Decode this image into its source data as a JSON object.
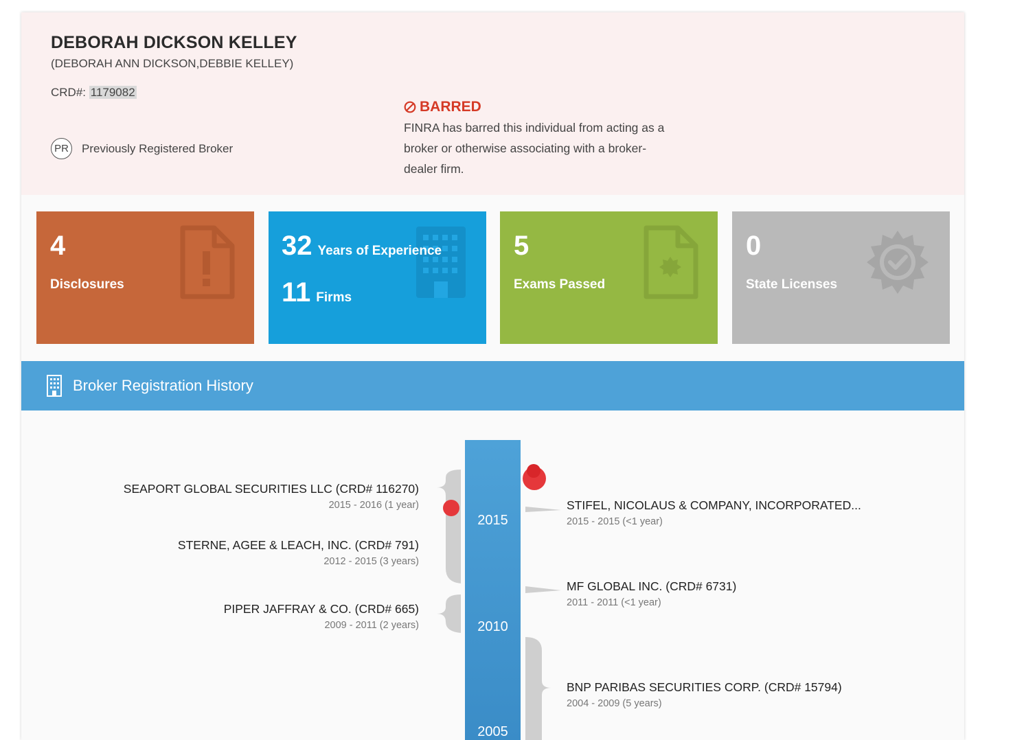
{
  "profile": {
    "name": "DEBORAH DICKSON KELLEY",
    "aliases": "(DEBORAH ANN DICKSON,DEBBIE KELLEY)",
    "crd_label": "CRD#:",
    "crd_number": "1179082",
    "status_badge": "PR",
    "status_label": "Previously Registered Broker"
  },
  "alert": {
    "title": "BARRED",
    "text": "FINRA has barred this individual from acting as a broker or otherwise associating with a broker-dealer firm.",
    "color": "#d53a26"
  },
  "tiles": {
    "disclosures": {
      "value": "4",
      "label": "Disclosures",
      "color": "#c6673a"
    },
    "experience": {
      "years_value": "32",
      "years_label": "Years of Experience",
      "firms_value": "11",
      "firms_label": "Firms",
      "color": "#169fdb"
    },
    "exams": {
      "value": "5",
      "label": "Exams Passed",
      "color": "#95b843"
    },
    "licenses": {
      "value": "0",
      "label": "State Licenses",
      "color": "#b9b9b9"
    }
  },
  "history": {
    "title": "Broker Registration History",
    "years": [
      "2015",
      "2010",
      "2005"
    ],
    "left": [
      {
        "firm": "SEAPORT GLOBAL SECURITIES LLC (CRD# 116270)",
        "dates": "2015 - 2016 (1 year)"
      },
      {
        "firm": "STERNE, AGEE & LEACH, INC. (CRD# 791)",
        "dates": "2012 - 2015 (3 years)"
      },
      {
        "firm": "PIPER JAFFRAY & CO. (CRD# 665)",
        "dates": "2009 - 2011 (2 years)"
      }
    ],
    "right": [
      {
        "firm": "STIFEL, NICOLAUS & COMPANY, INCORPORATED...",
        "dates": "2015 - 2015 (<1 year)"
      },
      {
        "firm": "MF GLOBAL INC. (CRD# 6731)",
        "dates": "2011 - 2011 (<1 year)"
      },
      {
        "firm": "BNP PARIBAS SECURITIES CORP. (CRD# 15794)",
        "dates": "2004 - 2009 (5 years)"
      }
    ]
  }
}
